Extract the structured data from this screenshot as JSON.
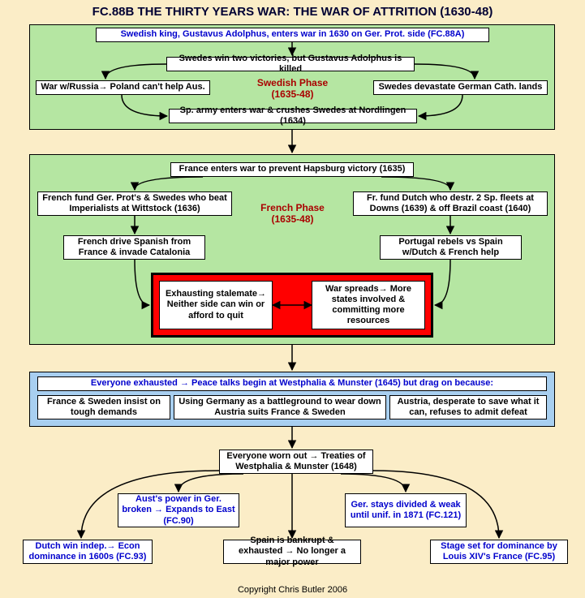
{
  "title": "FC.88B THE THIRTY YEARS WAR: THE WAR OF ATTRITION (1630-48)",
  "footer": "Copyright Chris Butler 2006",
  "swedish": {
    "label": "Swedish Phase\n(1635-48)",
    "entry": "Swedish king, Gustavus Adolphus, enters war  in 1630  on Ger. Prot. side (FC.88A)",
    "victories": "Swedes win two victories, but Gustavus Adolphus is killed",
    "russia": "War w/Russia→ Poland can't help Aus.",
    "devastate": "Swedes devastate German Cath. lands",
    "nordlingen": "Sp. army enters war & crushes Swedes at Nordlingen (1634)"
  },
  "french": {
    "label": "French Phase\n(1635-48)",
    "enters": "France enters war to prevent Hapsburg victory (1635)",
    "wittstock": "French fund Ger. Prot's & Swedes who beat Imperialists at Wittstock (1636)",
    "catalonia": "French drive Spanish from France & invade Catalonia",
    "downs": "Fr. fund Dutch who destr. 2 Sp. fleets at Downs (1639) & off Brazil coast (1640)",
    "portugal": "Portugal rebels vs Spain w/Dutch & French help",
    "stalemate": "Exhausting stalemate→ Neither side can win or afford to quit",
    "spreads": "War spreads→ More states involved & committing more resources"
  },
  "peace": {
    "header": "Everyone exhausted → Peace talks begin at Westphalia & Munster (1645) but drag on because:",
    "france": "France & Sweden insist on tough demands",
    "germany": "Using Germany as a battleground to wear down Austria suits France & Sweden",
    "austria": "Austria, desperate to save what it can, refuses to admit defeat"
  },
  "outcomes": {
    "treaties": "Everyone worn out → Treaties of Westphalia & Munster (1648)",
    "aust": "Aust's power in Ger. broken → Expands to East (FC.90)",
    "ger": "Ger. stays divided & weak until unif. in 1871 (FC.121)",
    "dutch": "Dutch win indep.→ Econ dominance in 1600s (FC.93)",
    "spain": "Spain is bankrupt & exhausted → No longer a major power",
    "louis": "Stage set for dominance by Louis XIV's France (FC.95)"
  }
}
